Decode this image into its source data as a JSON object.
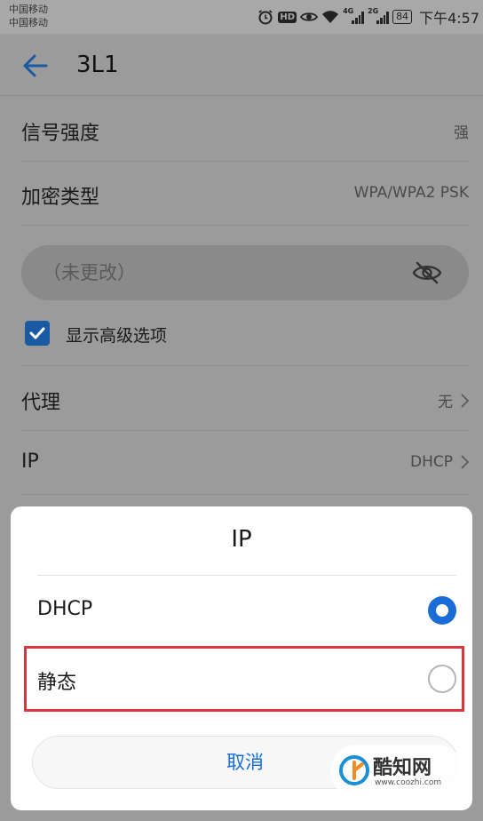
{
  "statusbar": {
    "carrier1": "中国移动",
    "carrier2": "中国移动",
    "hd": "HD",
    "net1": "4G",
    "net2": "2G",
    "battery": "84",
    "time": "下午4:57",
    "icons": [
      "alarm-icon",
      "eye-comfort-icon",
      "wifi-icon",
      "signal-icon"
    ]
  },
  "appbar": {
    "title": "3L1",
    "back_icon": "arrow-left-icon"
  },
  "rows": {
    "signal": {
      "label": "信号强度",
      "value": "强"
    },
    "encryption": {
      "label": "加密类型",
      "value": "WPA/WPA2 PSK"
    },
    "password": {
      "placeholder": "（未更改）",
      "icon": "eye-off-icon"
    },
    "advanced": {
      "label": "显示高级选项",
      "checked": true
    },
    "proxy": {
      "label": "代理",
      "value": "无"
    },
    "ip": {
      "label": "IP",
      "value": "DHCP"
    }
  },
  "dialog": {
    "title": "IP",
    "options": [
      {
        "label": "DHCP",
        "selected": true
      },
      {
        "label": "静态",
        "selected": false
      }
    ],
    "cancel": "取消"
  },
  "watermark": {
    "name": "酷知网",
    "url": "www.coozhi.com"
  },
  "colors": {
    "accent": "#1a6dd6",
    "highlight": "#d9363e",
    "checkbox": "#1a5aa3"
  }
}
